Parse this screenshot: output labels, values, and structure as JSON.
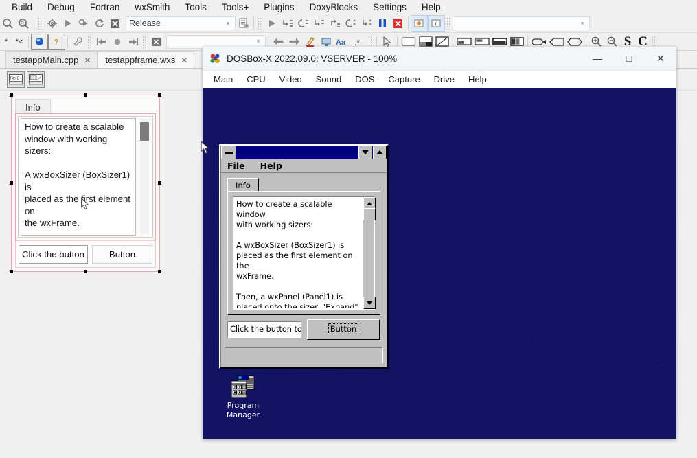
{
  "ide": {
    "menubar": [
      "Build",
      "Debug",
      "Fortran",
      "wxSmith",
      "Tools",
      "Tools+",
      "Plugins",
      "DoxyBlocks",
      "Settings",
      "Help"
    ],
    "toolbar_top": {
      "build_target": "Release",
      "build_target_placeholder": "Release",
      "icons": [
        "search-icon",
        "search-replace-icon",
        "build-gear-icon",
        "run-icon",
        "build-and-run-icon",
        "rebuild-icon",
        "abort-icon",
        "build-target-combo",
        "build-log-icon",
        "debug-run-icon",
        "debug-next-line-icon",
        "debug-step-into-icon",
        "debug-step-out-icon",
        "debug-next-instruction-icon",
        "debug-step-into-instruction-icon",
        "debug-run-to-cursor-icon",
        "debug-break-icon",
        "debug-stop-icon",
        "debugging-windows-icon",
        "various-info-icon"
      ]
    },
    "toolbar_bottom": {
      "search_value": "",
      "search_placeholder": "",
      "icons": [
        "comment-icon",
        "uncomment-icon",
        "class-browser-icon",
        "help-icon",
        "settings-wrench-icon",
        "jump-back-icon",
        "bookmark-dot-icon",
        "jump-forward-icon",
        "clear-highlight-icon",
        "incremental-search-input",
        "prev-result-icon",
        "next-result-icon",
        "highlight-icon",
        "select-target-icon",
        "match-case-icon",
        "regex-icon",
        "pointer-tool-icon",
        "panel-tool-icon",
        "splitter-tool-icon",
        "grid-tool-icon",
        "box-sizer-h-icon",
        "box-sizer-v-icon",
        "static-box-sizer-icon",
        "grid-sizer-icon",
        "spacer-icon",
        "stretch-spacer-icon",
        "custom-sizer-icon",
        "zoom-in-icon",
        "zoom-out-icon",
        "source-view-icon",
        "class-view-icon"
      ]
    },
    "tabs": [
      {
        "label": "testappMain.cpp",
        "active": false
      },
      {
        "label": "testappframe.wxs",
        "active": true
      }
    ],
    "mini_toolbar": [
      "menubar-tool-icon",
      "toolbar-tool-icon"
    ]
  },
  "designer": {
    "tab_label": "Info",
    "textctrl_value": "How to create a scalable\nwindow with working sizers:\n\nA wxBoxSizer (BoxSizer1) is\nplaced as the first element on\nthe wxFrame.\n\nThen, a wxPanel (Panel1) is\nplaced onto the sizer.\n\"Expand\" is selected, \"Border",
    "textfield_value": "Click the button to p",
    "button_label": "Button"
  },
  "dosbox": {
    "title": "DOSBox-X 2022.09.0: VSERVER - 100%",
    "icon": "dosbox-logo-icon",
    "window_buttons": {
      "minimize": "—",
      "maximize": "□",
      "close": "✕"
    },
    "menu": [
      "Main",
      "CPU",
      "Video",
      "Sound",
      "DOS",
      "Capture",
      "Drive",
      "Help"
    ],
    "canvas_color": "#101063"
  },
  "win31_app": {
    "title": "",
    "menu": [
      {
        "label": "File",
        "mnemonic": "F"
      },
      {
        "label": "Help",
        "mnemonic": "H"
      }
    ],
    "notebook_tab": "Info",
    "textctrl_value": "How to create a scalable window\nwith working sizers:\n\nA wxBoxSizer (BoxSizer1) is\nplaced as the first element on the\nwxFrame.\n\nThen, a wxPanel (Panel1) is\nplaced onto the sizer. \"Expand\" is\nselected, \"Border width\" is set to",
    "textfield_value": "Click the button to p",
    "button_label": "Button",
    "scroll_up_glyph": "▲",
    "scroll_down_glyph": "▼",
    "restore_glyph": "▼",
    "maximize_glyph": "▲"
  },
  "desktop_icon": {
    "label_line1": "Program",
    "label_line2": "Manager",
    "icon": "program-manager-icon"
  },
  "colors": {
    "ide_bg": "#f0f0f0",
    "dos_blue": "#101063",
    "win31_face": "#c0c0c0",
    "win31_title": "#000080",
    "selection_pink": "#eaa9a9"
  }
}
